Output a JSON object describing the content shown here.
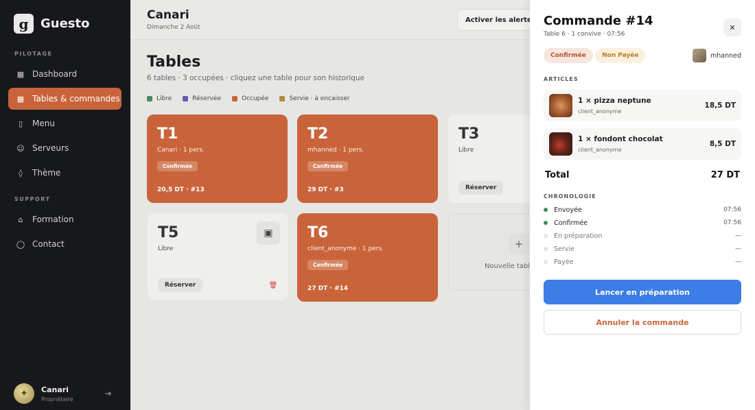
{
  "brand": {
    "logo": "g",
    "name": "Guesto"
  },
  "sidebar": {
    "section_pilotage": "PILOTAGE",
    "items": [
      {
        "label": "Dashboard",
        "icon": "dashboard-icon"
      },
      {
        "label": "Tables & commandes",
        "icon": "tables-icon"
      },
      {
        "label": "Menu",
        "icon": "book-icon"
      },
      {
        "label": "Serveurs",
        "icon": "users-icon"
      },
      {
        "label": "Thème",
        "icon": "drop-icon"
      }
    ],
    "section_support": "SUPPORT",
    "support_items": [
      {
        "label": "Formation",
        "icon": "graduation-icon"
      },
      {
        "label": "Contact",
        "icon": "chat-icon"
      }
    ],
    "user": {
      "name": "Canari",
      "role": "Propriétaire"
    }
  },
  "header": {
    "restaurant": "Canari",
    "date": "Dimanche 2 Août",
    "alert_button": "Activer les alertes"
  },
  "main": {
    "title": "Tables",
    "subtitle": "6 tables · 3 occupées · cliquez une table pour son historique",
    "legend": [
      {
        "label": "Libre",
        "color": "#4e8a5e"
      },
      {
        "label": "Réservée",
        "color": "#6a5ab0"
      },
      {
        "label": "Occupée",
        "color": "#c9643a"
      },
      {
        "label": "Servie · à encaisser",
        "color": "#b08a3e"
      }
    ],
    "tables": [
      {
        "num": "T1",
        "meta": "Canari · 1 pers.",
        "badge": "Confirmée",
        "footer": "20,5 DT · #13"
      },
      {
        "num": "T2",
        "meta": "mhanned · 1 pers.",
        "badge": "Confirmée",
        "footer": "29 DT · #3"
      },
      {
        "num": "T3",
        "meta": "Libre",
        "action": "Réserver"
      },
      {
        "num": "T5",
        "meta": "Libre",
        "action": "Réserver"
      },
      {
        "num": "T6",
        "meta": "client_anonyme · 1 pers.",
        "badge": "Confirmée",
        "footer": "27 DT · #14"
      }
    ],
    "new_table_label": "Nouvelle table"
  },
  "drawer": {
    "title": "Commande #14",
    "subtitle": "Table 6 · 1 convive · 07:56",
    "status_confirmed": "Confirmée",
    "status_payment": "Non Payée",
    "user": "mhanned",
    "articles_label": "ARTICLES",
    "articles": [
      {
        "name": "1 × pizza neptune",
        "client": "client_anonyme",
        "price": "18,5 DT"
      },
      {
        "name": "1 × fondont chocolat",
        "client": "client_anonyme",
        "price": "8,5 DT"
      }
    ],
    "total_label": "Total",
    "total_value": "27 DT",
    "timeline_label": "CHRONOLOGIE",
    "timeline": [
      {
        "label": "Envoyée",
        "time": "07:56",
        "done": true
      },
      {
        "label": "Confirmée",
        "time": "07:56",
        "done": true
      },
      {
        "label": "En préparation",
        "time": "—",
        "done": false
      },
      {
        "label": "Servie",
        "time": "—",
        "done": false
      },
      {
        "label": "Payée",
        "time": "—",
        "done": false
      }
    ],
    "primary_action": "Lancer en préparation",
    "cancel_action": "Annuler la commande"
  }
}
